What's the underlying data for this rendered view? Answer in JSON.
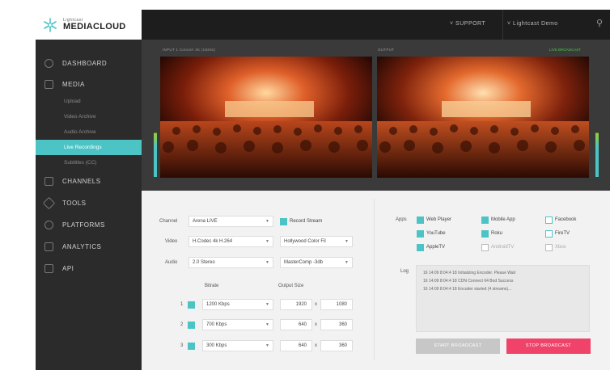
{
  "brand": {
    "line1": "Lightcast",
    "line2": "MEDIACLOUD"
  },
  "topbar": {
    "support": "SUPPORT",
    "user": "Lightcast Demo"
  },
  "sidebar": {
    "items": [
      {
        "label": "DASHBOARD",
        "icon": "dashboard-icon"
      },
      {
        "label": "MEDIA",
        "icon": "media-icon"
      },
      {
        "label": "CHANNELS",
        "icon": "channels-icon"
      },
      {
        "label": "TOOLS",
        "icon": "tools-icon"
      },
      {
        "label": "PLATFORMS",
        "icon": "platforms-icon"
      },
      {
        "label": "ANALYTICS",
        "icon": "analytics-icon"
      },
      {
        "label": "API",
        "icon": "api-icon"
      }
    ],
    "media_sub": [
      "Upload",
      "Video Archive",
      "Audio Archive",
      "Live Recordings",
      "Subtitles (CC)"
    ]
  },
  "video": {
    "input_label": "INPUT 1 Concert 4K (1920x)",
    "output_label": "OUTPUT",
    "status": "LIVE BROADCAST"
  },
  "form": {
    "channel_label": "Channel",
    "channel_value": "Arena LIVE",
    "record_label": "Record Stream",
    "video_label": "Video",
    "video_value": "H.Codec 4k H.264",
    "filter_value": "Hollywood Color Fil",
    "audio_label": "Audio",
    "audio_value": "2.0 Stereo",
    "audio_fx_value": "MasterComp -3db",
    "bitrate_header": "Bitrate",
    "output_header": "Output Size",
    "rows": [
      {
        "idx": "1",
        "bitrate": "1200 Kbps",
        "w": "1920",
        "h": "1080"
      },
      {
        "idx": "2",
        "bitrate": "700 Kbps",
        "w": "640",
        "h": "360"
      },
      {
        "idx": "3",
        "bitrate": "300 Kbps",
        "w": "640",
        "h": "360"
      }
    ],
    "x_sep": "x"
  },
  "apps": {
    "label": "Apps",
    "items": [
      {
        "label": "Web Player",
        "checked": true
      },
      {
        "label": "Mobile App",
        "checked": true
      },
      {
        "label": "Facebook",
        "checked": false
      },
      {
        "label": "YouTube",
        "checked": true
      },
      {
        "label": "Roku",
        "checked": true
      },
      {
        "label": "FireTV",
        "checked": false
      },
      {
        "label": "AppleTV",
        "checked": true
      },
      {
        "label": "AndroidTV",
        "checked": false
      },
      {
        "label": "Xbox",
        "checked": false
      }
    ]
  },
  "log": {
    "label": "Log",
    "lines": [
      "16 14:09 8:04:4 18  Initializing Encoder. Please Wait",
      "16 14:09 8:04:4 18  CDN Connect 64 Bod Success",
      "16 14:09 8:04:4 18  Encoder started (4 streams)..."
    ]
  },
  "buttons": {
    "start": "START BROADCAST",
    "stop": "STOP BROADCAST"
  },
  "colors": {
    "accent": "#4cc4c6",
    "stop": "#f0436a",
    "start_disabled": "#c7c7c7"
  }
}
